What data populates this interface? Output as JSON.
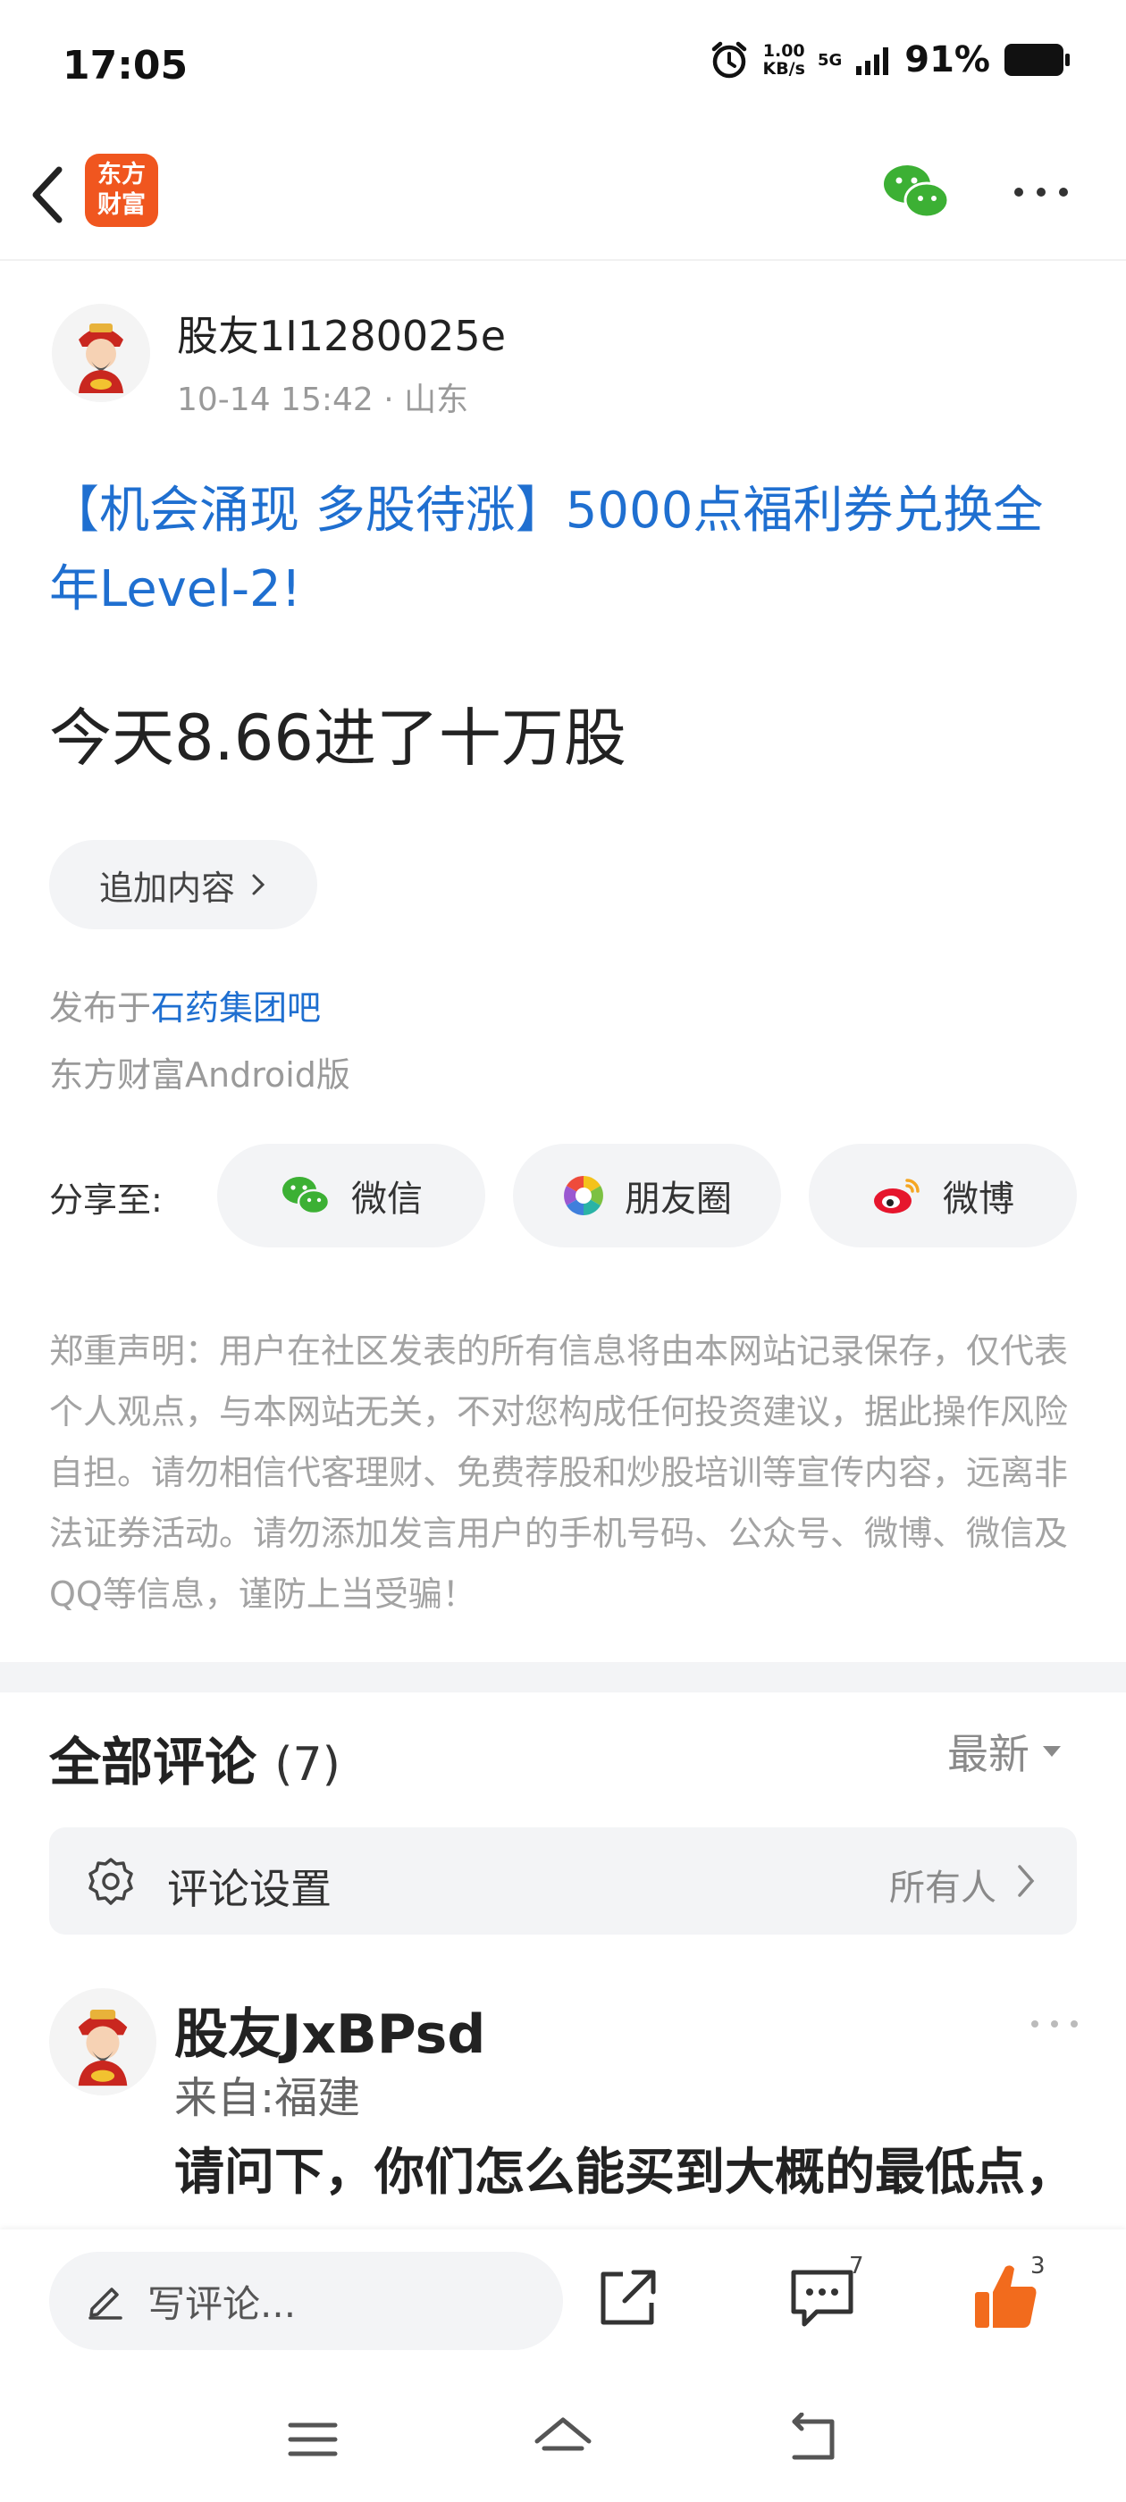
{
  "status_bar": {
    "time": "17:05",
    "net_speed_value": "1.00",
    "net_speed_unit": "KB/s",
    "network": "5G",
    "battery": "91%"
  },
  "topbar": {
    "logo_line1": "东方",
    "logo_line2": "财富",
    "icons": [
      "back-icon",
      "wechat-icon",
      "more-icon"
    ]
  },
  "post": {
    "author": "股友1I1280025e",
    "meta": "10-14 15:42 · 山东",
    "promo": "【机会涌现 多股待涨】5000点福利券兑换全年Level-2!",
    "body": "今天8.66进了十万股",
    "append_label": "追加内容",
    "published_prefix": "发布于",
    "published_bar": "石药集团吧",
    "client": "东方财富Android版"
  },
  "share": {
    "label": "分享至:",
    "wechat": "微信",
    "moments": "朋友圈",
    "weibo": "微博"
  },
  "disclaimer": "郑重声明：用户在社区发表的所有信息将由本网站记录保存，仅代表个人观点，与本网站无关，不对您构成任何投资建议，据此操作风险自担。请勿相信代客理财、免费荐股和炒股培训等宣传内容，远离非法证券活动。请勿添加发言用户的手机号码、公众号、微博、微信及QQ等信息，谨防上当受骗！",
  "comments": {
    "title": "全部评论",
    "count": "(7)",
    "sort": "最新",
    "settings_label": "评论设置",
    "settings_value": "所有人",
    "first": {
      "name": "股友JxBPsd",
      "location": "来自:福建",
      "text": "请问下，你们怎么能买到大概的最低点，"
    }
  },
  "action_bar": {
    "write_placeholder": "写评论...",
    "comment_count": "7",
    "like_count": "3"
  },
  "colors": {
    "link": "#1f6fd0",
    "brand": "#f0561f",
    "like": "#f26b1d",
    "wechat": "#3cb034"
  }
}
